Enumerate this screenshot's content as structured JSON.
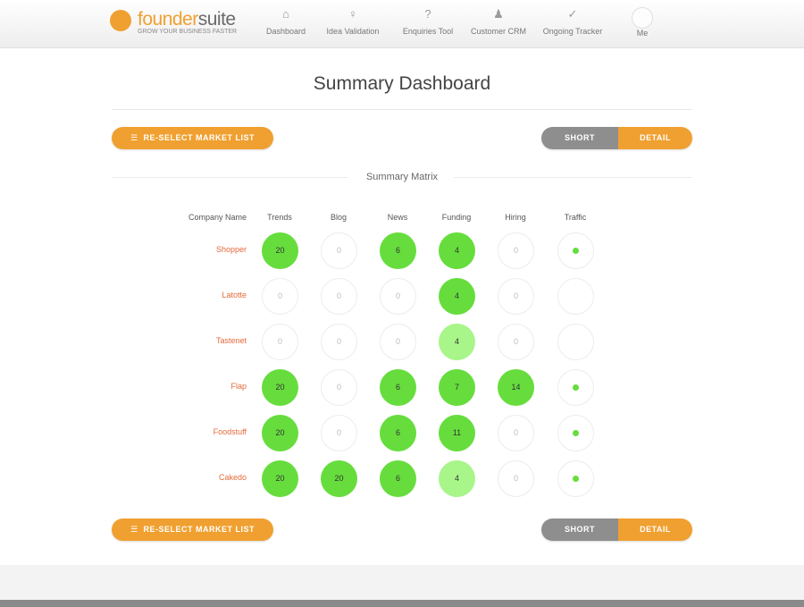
{
  "brand": {
    "name_part1": "founder",
    "name_part2": "suite",
    "tagline": "GROW YOUR BUSINESS FASTER"
  },
  "nav": {
    "items": [
      {
        "label": "Dashboard",
        "icon": "home-icon"
      },
      {
        "label": "Idea Validation",
        "icon": "lightbulb-icon"
      },
      {
        "label": "Enquiries Tool",
        "icon": "question-icon"
      },
      {
        "label": "Customer CRM",
        "icon": "people-icon"
      },
      {
        "label": "Ongoing Tracker",
        "icon": "checkmark-icon"
      },
      {
        "label": "Me",
        "icon": "avatar-icon"
      }
    ]
  },
  "page": {
    "title": "Summary Dashboard",
    "section_title": "Summary Matrix"
  },
  "actions": {
    "select_button": "RE-SELECT MARKET LIST",
    "toggle_left": "SHORT",
    "toggle_right": "DETAIL"
  },
  "matrix": {
    "corner_label": "Company Name",
    "columns": [
      "Trends",
      "Blog",
      "News",
      "Funding",
      "Hiring",
      "Traffic"
    ],
    "rows": [
      {
        "label": "Shopper",
        "cells": [
          {
            "type": "dark",
            "value": "20"
          },
          {
            "type": "empty",
            "value": "0"
          },
          {
            "type": "dark",
            "value": "6"
          },
          {
            "type": "dark",
            "value": "4"
          },
          {
            "type": "empty",
            "value": "0"
          },
          {
            "type": "dot",
            "value": ""
          }
        ]
      },
      {
        "label": "Latotte",
        "cells": [
          {
            "type": "empty",
            "value": "0"
          },
          {
            "type": "empty",
            "value": "0"
          },
          {
            "type": "empty",
            "value": "0"
          },
          {
            "type": "dark",
            "value": "4"
          },
          {
            "type": "empty",
            "value": "0"
          },
          {
            "type": "empty",
            "value": ""
          }
        ]
      },
      {
        "label": "Tastenet",
        "cells": [
          {
            "type": "empty",
            "value": "0"
          },
          {
            "type": "empty",
            "value": "0"
          },
          {
            "type": "empty",
            "value": "0"
          },
          {
            "type": "light",
            "value": "4"
          },
          {
            "type": "empty",
            "value": "0"
          },
          {
            "type": "empty",
            "value": ""
          }
        ]
      },
      {
        "label": "Flap",
        "cells": [
          {
            "type": "dark",
            "value": "20"
          },
          {
            "type": "empty",
            "value": "0"
          },
          {
            "type": "dark",
            "value": "6"
          },
          {
            "type": "dark",
            "value": "7"
          },
          {
            "type": "dark",
            "value": "14"
          },
          {
            "type": "dot",
            "value": ""
          }
        ]
      },
      {
        "label": "Foodstuff",
        "cells": [
          {
            "type": "dark",
            "value": "20"
          },
          {
            "type": "empty",
            "value": "0"
          },
          {
            "type": "dark",
            "value": "6"
          },
          {
            "type": "dark",
            "value": "11"
          },
          {
            "type": "empty",
            "value": "0"
          },
          {
            "type": "dot",
            "value": ""
          }
        ]
      },
      {
        "label": "Cakedo",
        "cells": [
          {
            "type": "dark",
            "value": "20"
          },
          {
            "type": "dark",
            "value": "20"
          },
          {
            "type": "dark",
            "value": "6"
          },
          {
            "type": "light",
            "value": "4"
          },
          {
            "type": "empty",
            "value": "0"
          },
          {
            "type": "dot",
            "value": ""
          }
        ]
      }
    ]
  },
  "colors": {
    "accent": "#f0a030",
    "green_strong": "#66dd3d",
    "green_light": "#a8f58a",
    "row_label": "#e46a3a",
    "toggle_inactive": "#8e8e8e"
  }
}
